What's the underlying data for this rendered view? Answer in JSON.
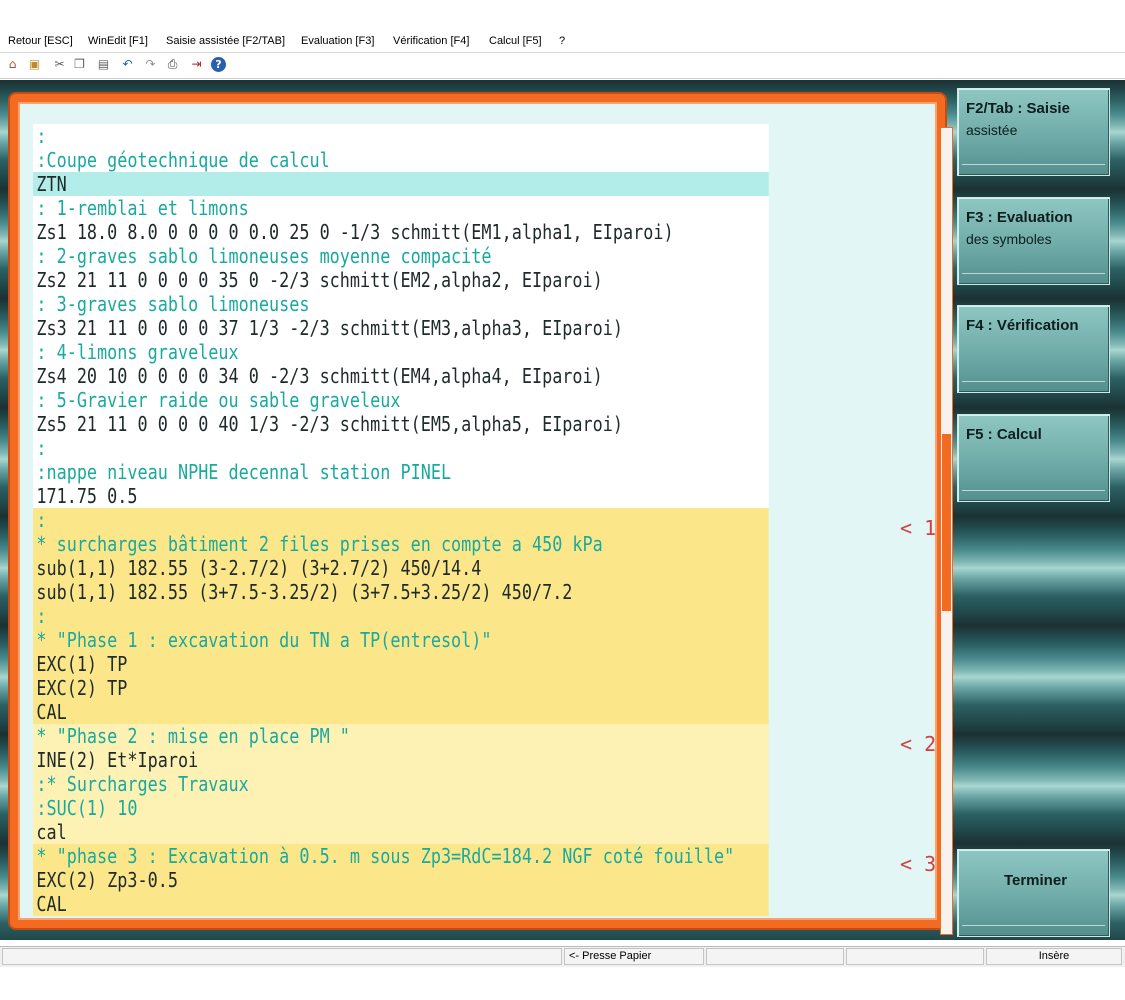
{
  "menu": {
    "items": [
      {
        "label": "Retour [ESC]"
      },
      {
        "label": "WinEdit [F1]"
      },
      {
        "label": "Saisie assistée [F2/TAB]"
      },
      {
        "label": "Evaluation [F3]"
      },
      {
        "label": "Vérification [F4]"
      },
      {
        "label": "Calcul [F5]"
      },
      {
        "label": "?"
      }
    ]
  },
  "toolbar": {
    "icons": [
      "home-icon",
      "open-icon",
      "cut-icon",
      "copy-icon",
      "paste-icon",
      "undo-icon",
      "redo-icon",
      "print-icon",
      "exit-icon",
      "help-icon"
    ]
  },
  "editor": {
    "lines": [
      {
        "text": ":",
        "color": "#1aa99f",
        "bg": "#ffffff"
      },
      {
        "text": ":Coupe géotechnique de calcul",
        "color": "#1aa99f",
        "bg": "#ffffff"
      },
      {
        "text": "ZTN",
        "color": "#1f2a2a",
        "bg": "#b2ede9"
      },
      {
        "text": ": 1-remblai et limons",
        "color": "#1aa99f",
        "bg": "#ffffff"
      },
      {
        "text": "Zs1 18.0 8.0 0 0 0 0 0.0 25 0 -1/3 schmitt(EM1,alpha1, EIparoi)",
        "color": "#1f2a2a",
        "bg": "#ffffff"
      },
      {
        "text": ": 2-graves sablo limoneuses moyenne compacité",
        "color": "#1aa99f",
        "bg": "#ffffff"
      },
      {
        "text": "Zs2 21 11 0 0 0 0 35 0 -2/3 schmitt(EM2,alpha2, EIparoi)",
        "color": "#1f2a2a",
        "bg": "#ffffff"
      },
      {
        "text": ": 3-graves sablo limoneuses",
        "color": "#1aa99f",
        "bg": "#ffffff"
      },
      {
        "text": "Zs3 21 11 0 0 0 0 37 1/3 -2/3 schmitt(EM3,alpha3, EIparoi)",
        "color": "#1f2a2a",
        "bg": "#ffffff"
      },
      {
        "text": ": 4-limons graveleux",
        "color": "#1aa99f",
        "bg": "#ffffff"
      },
      {
        "text": "Zs4 20 10 0 0 0 0 34 0 -2/3 schmitt(EM4,alpha4, EIparoi)",
        "color": "#1f2a2a",
        "bg": "#ffffff"
      },
      {
        "text": ": 5-Gravier raide ou sable graveleux",
        "color": "#1aa99f",
        "bg": "#ffffff"
      },
      {
        "text": "Zs5 21 11 0 0 0 0 40 1/3 -2/3 schmitt(EM5,alpha5, EIparoi)",
        "color": "#1f2a2a",
        "bg": "#ffffff"
      },
      {
        "text": ":",
        "color": "#1aa99f",
        "bg": "#ffffff"
      },
      {
        "text": ":nappe niveau NPHE decennal station PINEL",
        "color": "#1aa99f",
        "bg": "#ffffff"
      },
      {
        "text": "171.75 0.5",
        "color": "#1f2a2a",
        "bg": "#ffffff"
      },
      {
        "text": ":",
        "color": "#1aa99f",
        "bg": "#fbe78a",
        "tag": "< 1"
      },
      {
        "text": "* surcharges bâtiment 2 files prises en compte a 450 kPa",
        "color": "#1aa99f",
        "bg": "#fbe78a"
      },
      {
        "text": "sub(1,1) 182.55 (3-2.7/2) (3+2.7/2) 450/14.4",
        "color": "#1f2a2a",
        "bg": "#fbe78a"
      },
      {
        "text": "sub(1,1) 182.55 (3+7.5-3.25/2) (3+7.5+3.25/2) 450/7.2",
        "color": "#1f2a2a",
        "bg": "#fbe78a"
      },
      {
        "text": ":",
        "color": "#1aa99f",
        "bg": "#fbe78a"
      },
      {
        "text": "* \"Phase 1 : excavation du TN a TP(entresol)\"",
        "color": "#1aa99f",
        "bg": "#fbe78a"
      },
      {
        "text": "EXC(1) TP",
        "color": "#1f2a2a",
        "bg": "#fbe78a"
      },
      {
        "text": "EXC(2) TP",
        "color": "#1f2a2a",
        "bg": "#fbe78a"
      },
      {
        "text": "CAL",
        "color": "#1f2a2a",
        "bg": "#fbe78a"
      },
      {
        "text": "* \"Phase 2 : mise en place PM \"",
        "color": "#1aa99f",
        "bg": "#fdf1b4",
        "tag": "< 2"
      },
      {
        "text": "INE(2) Et*Iparoi",
        "color": "#1f2a2a",
        "bg": "#fdf1b4"
      },
      {
        "text": ":* Surcharges Travaux",
        "color": "#1aa99f",
        "bg": "#fdf1b4"
      },
      {
        "text": ":SUC(1) 10",
        "color": "#1aa99f",
        "bg": "#fdf1b4"
      },
      {
        "text": "cal",
        "color": "#1f2a2a",
        "bg": "#fdf1b4"
      },
      {
        "text": "* \"phase 3 : Excavation à 0.5. m sous Zp3=RdC=184.2 NGF coté fouille\"",
        "color": "#1aa99f",
        "bg": "#fbe78a",
        "tag": "< 3"
      },
      {
        "text": "EXC(2) Zp3-0.5",
        "color": "#1f2a2a",
        "bg": "#fbe78a"
      },
      {
        "text": "CAL",
        "color": "#1f2a2a",
        "bg": "#fbe78a"
      }
    ]
  },
  "scroll": {
    "position_fraction": 0.38,
    "visible_fraction": 0.22
  },
  "function_buttons": [
    {
      "key": "F2/Tab : Saisie",
      "sub": "assistée"
    },
    {
      "key": "F3 : Evaluation",
      "sub": "des symboles"
    },
    {
      "key": "F4 : Vérification",
      "sub": ""
    },
    {
      "key": "F5 : Calcul",
      "sub": ""
    },
    {
      "key": "Terminer",
      "sub": ""
    }
  ],
  "status": {
    "clipboard": "<- Presse Papier",
    "mode": "Insère"
  },
  "colors": {
    "accent": "#f36b21",
    "comment": "#1aa99f",
    "code": "#1f2a2a",
    "phase_bg": "#fbe78a",
    "phase_bg_light": "#fdf1b4",
    "highlight_line": "#b2ede9"
  }
}
